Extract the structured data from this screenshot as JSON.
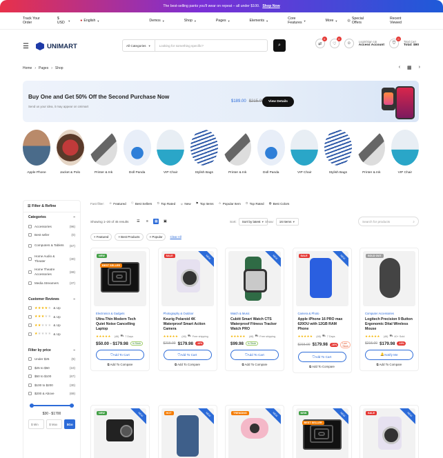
{
  "banner": {
    "text": "The best-selling pants you'll wear on repeat – all under $100.",
    "link": "Shop Now"
  },
  "topbar": {
    "track": "Track Your Order",
    "currency": "$ USD",
    "language": "English",
    "nav": [
      "Demos",
      "Shop",
      "Pages",
      "Elements",
      "Core Features",
      "More"
    ],
    "special": "Special Offers",
    "recent": "Recent Viewed"
  },
  "header": {
    "logo": "UNIMART",
    "search_category": "All Categories",
    "search_placeholder": "Looking for something specific?",
    "compare_badge": "0",
    "wishlist_badge": "0",
    "account_l1": "Login/Sign Up",
    "account_l2": "Access Account",
    "cart_badge": "0",
    "cart_l1": "Total Cart",
    "cart_l2": "Total: $90"
  },
  "breadcrumb": [
    "Home",
    "Pages",
    "Shop"
  ],
  "promo": {
    "title": "Buy One and Get 50% Off the Second Purchase Now",
    "subtitle": "Send us your idea, it may appear on Unimart",
    "price": "$189.00",
    "old_price": "$215.00",
    "button": "View Details"
  },
  "categories": [
    "Apple Phone",
    "Jacket & Polo",
    "Printer & Ink",
    "Doll Panda",
    "VIP Chair",
    "Stylish Bags",
    "Printer & Ink",
    "Doll Panda",
    "VIP Chair",
    "Stylish Bags",
    "Printer & Ink",
    "VIP Chair"
  ],
  "sidebar": {
    "title": "Filter & Refine",
    "categories_title": "Categories",
    "categories": [
      {
        "label": "Accessories",
        "count": "(96)"
      },
      {
        "label": "Best seller",
        "count": "(0)"
      },
      {
        "label": "Computers & Tablets",
        "count": "(67)"
      },
      {
        "label": "Home Audio & Theater",
        "count": "(30)"
      },
      {
        "label": "Home Theatre Accessories",
        "count": "(69)"
      },
      {
        "label": "Media Streamers",
        "count": "(37)"
      }
    ],
    "reviews_title": "Customer Reviews",
    "reviews": [
      {
        "stars": 4,
        "label": "& Up"
      },
      {
        "stars": 3,
        "label": "& Up"
      },
      {
        "stars": 2,
        "label": "& Up"
      },
      {
        "stars": 1,
        "label": "& Up"
      }
    ],
    "price_title": "Filter by price",
    "prices": [
      {
        "label": "Under $25",
        "count": "(9)"
      },
      {
        "label": "$25 to $50",
        "count": "(10)"
      },
      {
        "label": "$50 to $100",
        "count": "(67)"
      },
      {
        "label": "$100 to $200",
        "count": "(30)"
      },
      {
        "label": "$200 & Above",
        "count": "(69)"
      }
    ],
    "range_label": "$30 - $1700",
    "min_ph": "$ Min",
    "max_ph": "$ Max",
    "go": "$Go"
  },
  "fast_filter": {
    "label": "Fast filter:",
    "chips": [
      "Featured",
      "Best Sellers",
      "Top Rated",
      "New",
      "Top Items",
      "Popular Item",
      "Top Rated",
      "Best Colors"
    ]
  },
  "toolbar": {
    "showing": "Showing 1–20 of 45 results",
    "sort_label": "Sort:",
    "sort_value": "Sort by latest",
    "show_label": "Show:",
    "show_value": "16 Items",
    "search_ph": "Search for products"
  },
  "active_filters": {
    "chips": [
      "Featured",
      "Best Products",
      "Popular"
    ],
    "clear": "Clear All"
  },
  "products": [
    {
      "tag": "NEW",
      "tag_color": "#43a047",
      "tag2": "BEST SELLER",
      "tag2_color": "#f57c00",
      "ribbon": "",
      "category": "Electronics & Gadgets",
      "name": "Ultra-Thin Modern Tech Quiet Noise Cancelling Laptop",
      "reviews": "(46)",
      "ship": "7 Days",
      "price": "$50.00 - $179.98",
      "old_price": "",
      "sale": "",
      "stock": "In Stock",
      "low": "",
      "button": "Add To Cart",
      "compare": "Add To Compare"
    },
    {
      "tag": "SALE",
      "tag_color": "#e53935",
      "tag2": "",
      "tag2_color": "",
      "ribbon": "NEW",
      "category": "Photography & Outdoor",
      "name": "Keurig Polaroid 4K Waterproof Smart Action Camera",
      "reviews": "(46)",
      "ship": "Free shipping",
      "price": "$179.98",
      "old_price": "$215.00",
      "sale": "-16%",
      "stock": "",
      "low": "",
      "button": "Add To Cart",
      "compare": "Add To Compare"
    },
    {
      "tag": "",
      "tag_color": "",
      "tag2": "",
      "tag2_color": "",
      "ribbon": "NEW",
      "category": "Watch & Music",
      "name": "Cubitt Smart Watch CTS Waterproof Fitness Tracker Watch PRO",
      "reviews": "(46)",
      "ship": "Free shipping",
      "price": "$99.98",
      "old_price": "",
      "sale": "",
      "stock": "In Stock",
      "low": "",
      "button": "Add To Cart",
      "compare": "Add To Compare"
    },
    {
      "tag": "SALE",
      "tag_color": "#e53935",
      "tag2": "",
      "tag2_color": "",
      "ribbon": "NEW",
      "category": "Camera & Photo",
      "name": "Apple iPhone 16 PRO max 620OU with 12GB RAM Phone",
      "reviews": "(46)",
      "ship": "7 Days",
      "price": "$179.98",
      "old_price": "$215.00",
      "sale": "-16%",
      "stock": "",
      "low": "Low Stock",
      "button": "Add To Cart",
      "compare": "Add To Compare"
    },
    {
      "tag": "SOLD OUT",
      "tag_color": "#9e9e9e",
      "tag2": "",
      "tag2_color": "",
      "ribbon": "",
      "category": "Computer Accessories",
      "name": "Logitech Precision 9 Button Ergonomic Dital Wireless Mouse",
      "reviews": "(46)",
      "ship": "40+ Sold",
      "price": "$179.98",
      "old_price": "$215.00",
      "sale": "-16%",
      "stock": "",
      "low": "",
      "button": "Notify Me",
      "compare": "Add To Compare"
    },
    {
      "tag": "NEW",
      "tag_color": "#43a047",
      "tag2": "",
      "tag2_color": "",
      "ribbon": "NEW",
      "category": "",
      "name": "",
      "reviews": "",
      "ship": "",
      "price": "",
      "old_price": "",
      "sale": "",
      "stock": "",
      "low": "",
      "button": "",
      "compare": ""
    },
    {
      "tag": "HOT",
      "tag_color": "#f57c00",
      "tag2": "",
      "tag2_color": "",
      "ribbon": "NEW",
      "category": "",
      "name": "",
      "reviews": "",
      "ship": "",
      "price": "",
      "old_price": "",
      "sale": "",
      "stock": "",
      "low": "",
      "button": "",
      "compare": ""
    },
    {
      "tag": "TRENDING",
      "tag_color": "#f57c00",
      "tag2": "",
      "tag2_color": "",
      "ribbon": "NEW",
      "category": "",
      "name": "",
      "reviews": "",
      "ship": "",
      "price": "",
      "old_price": "",
      "sale": "",
      "stock": "",
      "low": "",
      "button": "",
      "compare": ""
    },
    {
      "tag": "NEW",
      "tag_color": "#43a047",
      "tag2": "BEST SELLER",
      "tag2_color": "#f57c00",
      "ribbon": "NEW",
      "category": "",
      "name": "",
      "reviews": "",
      "ship": "",
      "price": "",
      "old_price": "",
      "sale": "",
      "stock": "",
      "low": "",
      "button": "",
      "compare": ""
    },
    {
      "tag": "SALE",
      "tag_color": "#e53935",
      "tag2": "",
      "tag2_color": "",
      "ribbon": "NEW",
      "category": "",
      "name": "",
      "reviews": "",
      "ship": "",
      "price": "",
      "old_price": "",
      "sale": "",
      "stock": "",
      "low": "",
      "button": "",
      "compare": ""
    }
  ]
}
